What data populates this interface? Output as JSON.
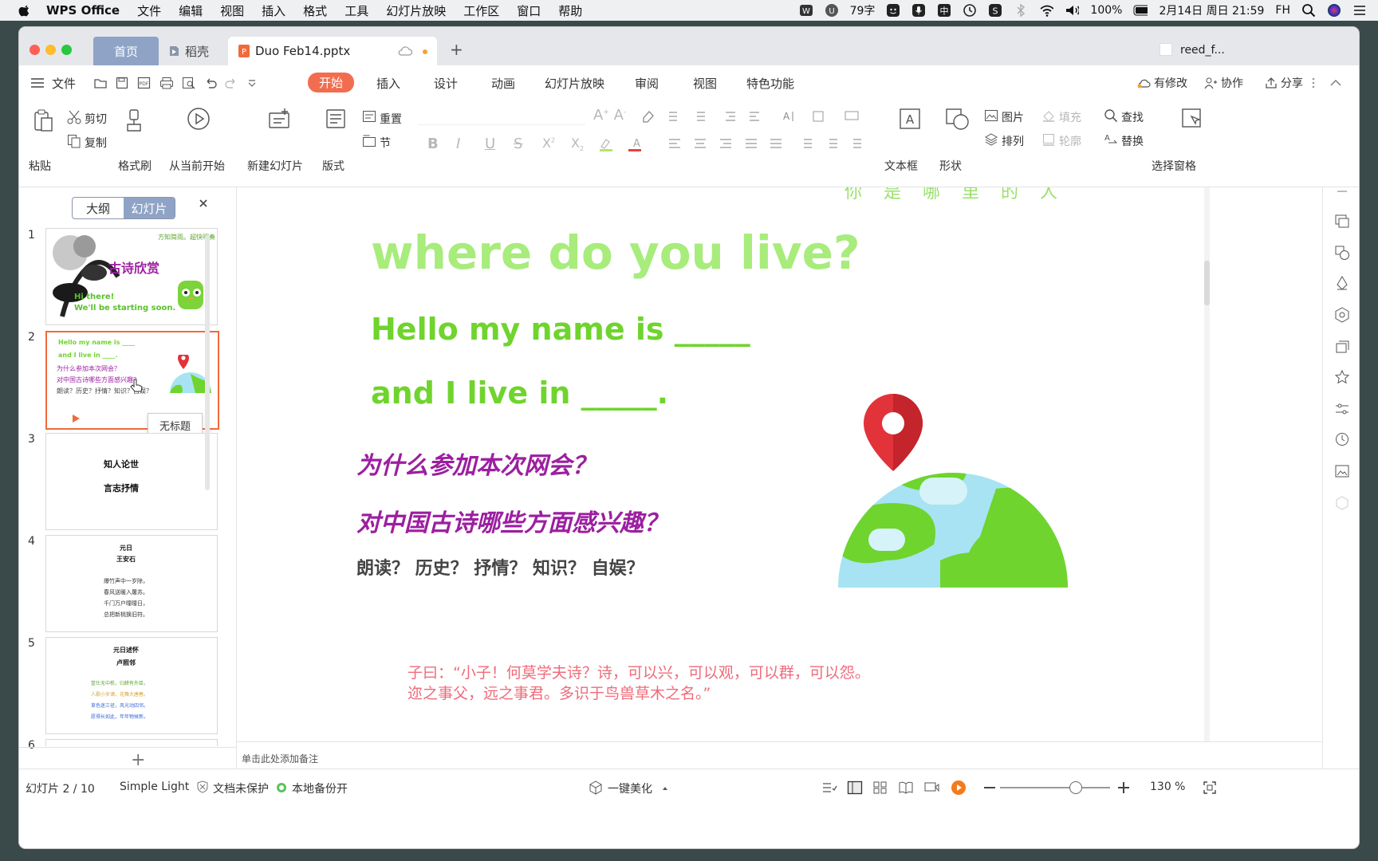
{
  "menubar": {
    "app_name": "WPS Office",
    "items": [
      "文件",
      "编辑",
      "视图",
      "插入",
      "格式",
      "工具",
      "幻灯片放映",
      "工作区",
      "窗口",
      "帮助"
    ],
    "word_count": "79字",
    "battery": "100%",
    "datetime": "2月14日 周日  21:59",
    "user": "FH"
  },
  "tabs": {
    "home": "首页",
    "daoke": "稻壳",
    "file": "Duo Feb14.pptx",
    "add": "+",
    "side_window": "reed_f..."
  },
  "ribbon": {
    "file_menu": "文件",
    "tabs": [
      "开始",
      "插入",
      "设计",
      "动画",
      "幻灯片放映",
      "审阅",
      "视图",
      "特色功能"
    ],
    "modified": "有修改",
    "collab": "协作",
    "share": "分享"
  },
  "toolbar": {
    "paste": "粘贴",
    "cut": "剪切",
    "copy": "复制",
    "format_painter": "格式刷",
    "play_from_current": "从当前开始",
    "new_slide": "新建幻灯片",
    "layout": "版式",
    "reset": "重置",
    "section": "节",
    "textbox": "文本框",
    "shape": "形状",
    "picture": "图片",
    "arrange": "排列",
    "fill": "填充",
    "outline": "轮廓",
    "find": "查找",
    "replace": "替换",
    "selection_pane": "选择窗格"
  },
  "left_panel": {
    "outline_tab": "大纲",
    "slides_tab": "幻灯片",
    "tooltip": "无标题",
    "add": "+",
    "thumbnails": [
      {
        "num": "1",
        "title": "古诗欣赏",
        "top_text": "方知简雨。超快明奏",
        "hi": "Hi there!",
        "soon": "We'll be starting soon."
      },
      {
        "num": "2",
        "lines": [
          "Hello my name is ____",
          "and I live in ____.",
          "为什么参加本次网会？",
          "对中国古诗哪些方面感兴趣？",
          "朗读？历史？抒情？知识？自娱？"
        ]
      },
      {
        "num": "3",
        "lines": [
          "知人论世",
          "言志抒情"
        ]
      },
      {
        "num": "4",
        "lines": [
          "元日",
          "王安石",
          "爆竹声中一岁除，",
          "春风送暖入屠苏。",
          "千门万户曈曈日，",
          "总把新桃换旧符。"
        ]
      },
      {
        "num": "5",
        "lines": [
          "元日述怀",
          "卢照邻",
          "筮仕无中秩，归耕有外臣。",
          "人歌小岁酒，花舞大唐春。",
          "草色迷三径，风光动四邻。",
          "愿得长如此，年年物候新。"
        ]
      },
      {
        "num": "6"
      }
    ]
  },
  "slide": {
    "top_partial": "你 是 哪 里 的 人",
    "title": "where do you live?",
    "line1": "Hello my name is _____",
    "line2": "and I live in _____.",
    "q1": "为什么参加本次网会？",
    "q2": "对中国古诗哪些方面感兴趣？",
    "q3": "朗读？ 历史？ 抒情？ 知识？ 自娱？",
    "quote1": "子曰：“小子！何莫学夫诗？诗，可以兴，可以观，可以群，可以怨。",
    "quote2": "迩之事父，远之事君。多识于鸟兽草木之名。”",
    "colors": {
      "title": "#a8ec7c",
      "green": "#6fd42d",
      "purple": "#9c1fa0",
      "dark": "#444444",
      "quote": "#ef6b7a"
    }
  },
  "notes_placeholder": "单击此处添加备注",
  "status": {
    "slide_counter": "幻灯片 2 / 10",
    "theme": "Simple Light",
    "protect": "文档未保护",
    "backup": "本地备份开",
    "beautify": "一键美化",
    "zoom": "130 %",
    "zoom_fraction": 0.68
  }
}
